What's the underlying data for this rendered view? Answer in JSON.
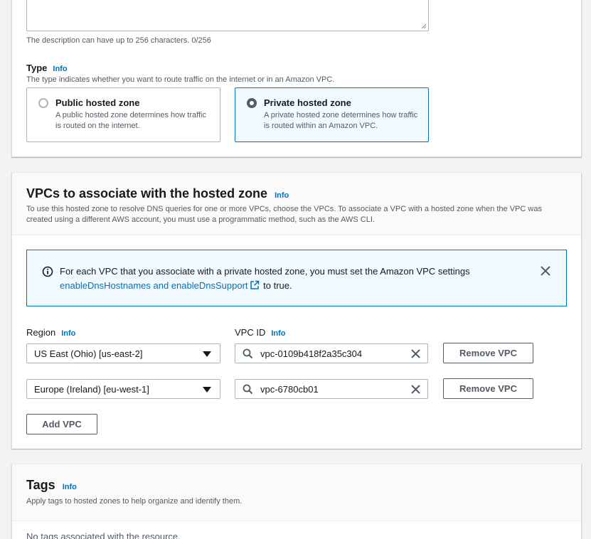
{
  "description": {
    "value": "",
    "hint": "The description can have up to 256 characters. 0/256"
  },
  "type": {
    "label": "Type",
    "info": "Info",
    "hint": "The type indicates whether you want to route traffic on the internet or in an Amazon VPC.",
    "options": [
      {
        "title": "Public hosted zone",
        "desc": "A public hosted zone determines how traffic is routed on the internet.",
        "selected": false
      },
      {
        "title": "Private hosted zone",
        "desc": "A private hosted zone determines how traffic is routed within an Amazon VPC.",
        "selected": true
      }
    ]
  },
  "vpcs": {
    "title": "VPCs to associate with the hosted zone",
    "info": "Info",
    "desc": "To use this hosted zone to resolve DNS queries for one or more VPCs, choose the VPCs. To associate a VPC with a hosted zone when the VPC was created using a different AWS account, you must use a programmatic method, such as the AWS CLI.",
    "alert": {
      "text": "For each VPC that you associate with a private hosted zone, you must set the Amazon VPC settings",
      "link": "enableDnsHostnames and enableDnsSupport",
      "suffix": " to true."
    },
    "region_label": "Region",
    "vpcid_label": "VPC ID",
    "info_label": "Info",
    "rows": [
      {
        "region": "US East (Ohio) [us-east-2]",
        "vpc_id": "vpc-0109b418f2a35c304",
        "remove": "Remove VPC"
      },
      {
        "region": "Europe (Ireland) [eu-west-1]",
        "vpc_id": "vpc-6780cb01",
        "remove": "Remove VPC"
      }
    ],
    "add_label": "Add VPC"
  },
  "tags": {
    "title": "Tags",
    "info": "Info",
    "desc": "Apply tags to hosted zones to help organize and identify them.",
    "empty": "No tags associated with the resource."
  },
  "colors": {
    "accent": "#0073bb",
    "border": "#aab7b8",
    "text": "#16191f",
    "secondary": "#545b64"
  },
  "icons": [
    "info-circle-icon",
    "close-icon",
    "external-link-icon",
    "search-icon",
    "clear-icon",
    "caret-down-icon"
  ]
}
